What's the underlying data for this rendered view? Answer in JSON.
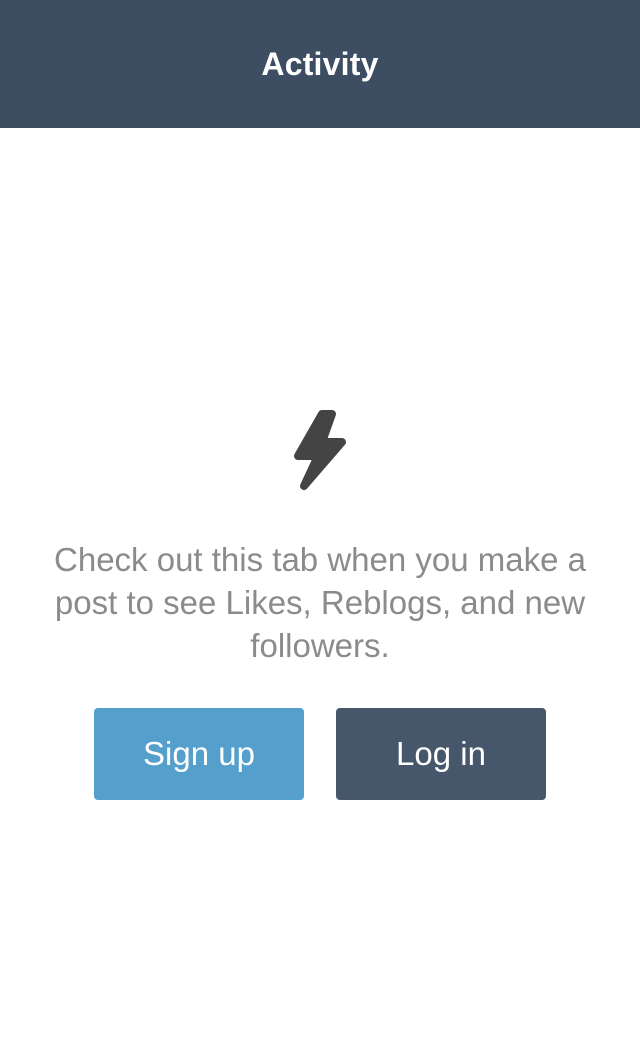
{
  "header": {
    "title": "Activity",
    "background": "#3d4d62"
  },
  "empty_state": {
    "icon": "lightning-bolt-icon",
    "message": "Check out this tab when you make a post to see Likes, Reblogs, and new followers."
  },
  "actions": {
    "signup_label": "Sign up",
    "signup_color": "#549fcc",
    "login_label": "Log in",
    "login_color": "#46566b"
  }
}
